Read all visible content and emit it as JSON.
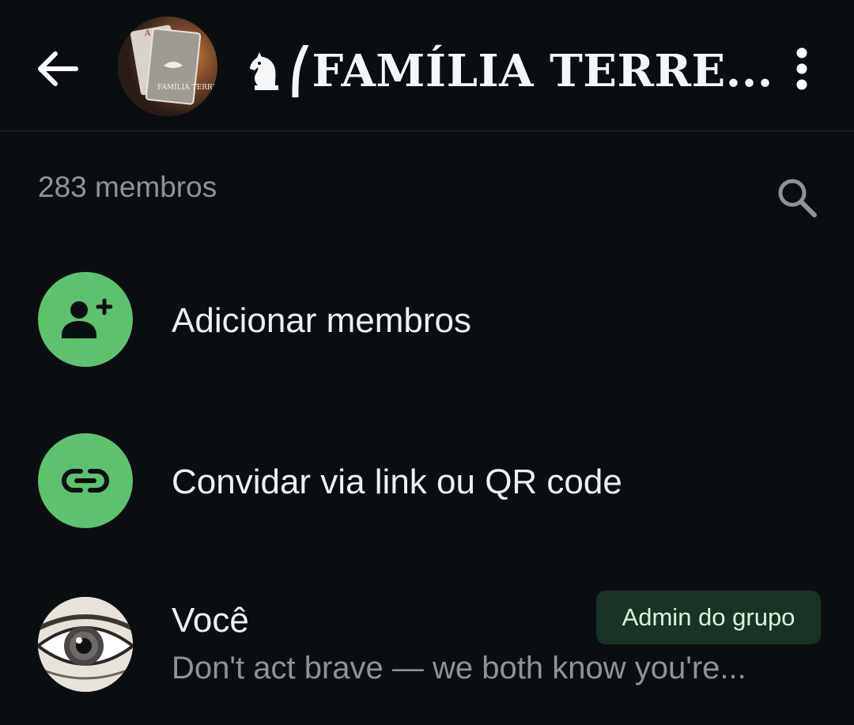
{
  "header": {
    "title": "♞⎛FAMÍLIA TERRE...",
    "title_text": "⎛FAMÍLIA TERRE...",
    "avatar_caption": "FAMÍLIA TERREMOTO",
    "back_icon": "arrow-left-icon",
    "menu_icon": "more-vertical-icon"
  },
  "members": {
    "count_label": "283 membros",
    "search_icon": "search-icon"
  },
  "actions": [
    {
      "label": "Adicionar membros",
      "icon": "add-person-icon"
    },
    {
      "label": "Convidar via link ou QR code",
      "icon": "link-icon"
    }
  ],
  "member_list": [
    {
      "name": "Você",
      "status": "Don't act brave — we both know you're...",
      "badge": "Admin do grupo",
      "avatar_icon": "eye-avatar"
    }
  ],
  "colors": {
    "background": "#0b0e11",
    "accent_green": "#5ec16e",
    "badge_bg": "#1b3326",
    "badge_text": "#d7f5dc",
    "secondary_text": "#8a959b"
  }
}
